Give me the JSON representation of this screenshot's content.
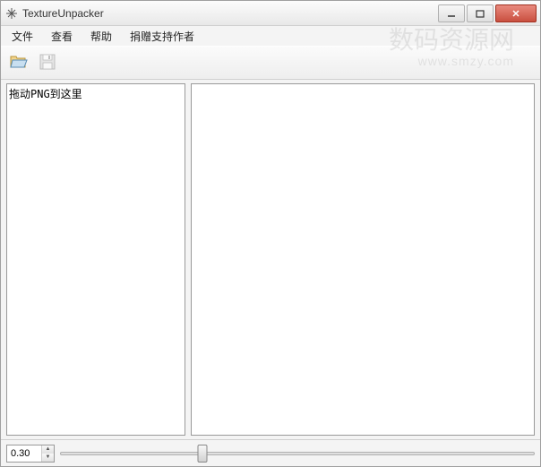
{
  "window": {
    "title": "TextureUnpacker"
  },
  "menu": {
    "file": "文件",
    "view": "查看",
    "help": "帮助",
    "donate": "捐赠支持作者"
  },
  "toolbar": {
    "open_tooltip": "打开",
    "save_tooltip": "保存"
  },
  "left_panel": {
    "drop_hint": "拖动PNG到这里"
  },
  "status": {
    "zoom_value": "0.30",
    "slider_value": 0.3
  },
  "watermark": {
    "main": "数码资源网",
    "sub": "www.smzy.com"
  }
}
